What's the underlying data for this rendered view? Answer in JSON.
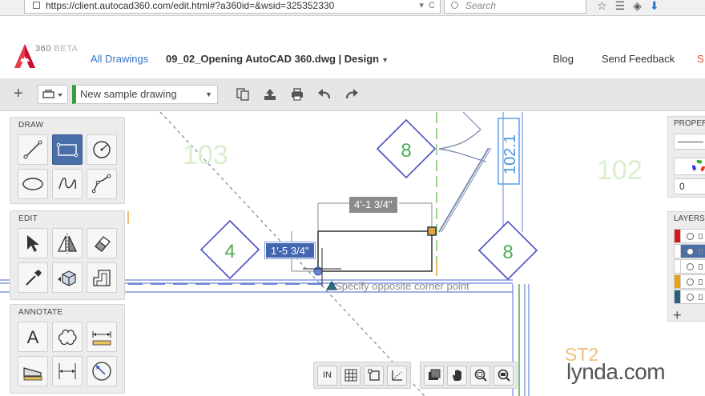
{
  "browser": {
    "url": "https://client.autocad360.com/edit.html#?a360id=&wsid=325352330",
    "search_placeholder": "Search"
  },
  "header": {
    "logo_text": "360",
    "logo_beta": "BETA",
    "all_drawings": "All Drawings",
    "doc_title": "09_02_Opening AutoCAD 360.dwg | Design",
    "blog": "Blog",
    "send_feedback": "Send Feedback",
    "cut_item": "S"
  },
  "toolbar": {
    "drawing_name": "New sample drawing"
  },
  "panels": {
    "draw_title": "DRAW",
    "edit_title": "EDIT",
    "annotate_title": "ANNOTATE",
    "properties_title": "PROPER",
    "layers_title": "LAYERS",
    "properties_value": "0"
  },
  "canvas": {
    "room_103": "103",
    "room_102": "102",
    "tag_102_1": "102.1",
    "tag_8_top": "8",
    "tag_4": "4",
    "tag_8_right": "8",
    "dim_horizontal": "4'-1 3/4\"",
    "dim_vertical": "1'-5 3/4\"",
    "prompt": "Specify opposite corner point",
    "layer_colors": [
      "#d8191b",
      "#ffffff",
      "#ffffff",
      "#e6a114",
      "#2a5f7f"
    ]
  },
  "bottom_bar": {
    "in_label": "IN"
  },
  "watermark": {
    "st2": "ST2",
    "lynda": "lynda",
    "com": ".com"
  },
  "colors": {
    "accent": "#3474c6",
    "active_tool": "#4a6fa8",
    "drawing_blue": "#3b57b8",
    "drawing_green": "#4caf50"
  }
}
